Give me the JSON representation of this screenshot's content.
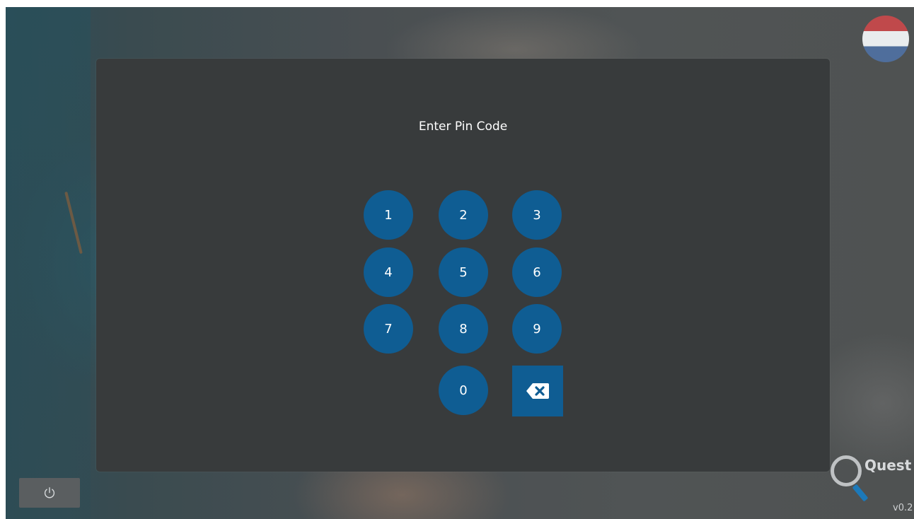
{
  "dialog": {
    "title": "Enter Pin Code"
  },
  "keypad": {
    "keys": [
      "1",
      "2",
      "3",
      "4",
      "5",
      "6",
      "7",
      "8",
      "9",
      "0"
    ],
    "backspace_icon": "backspace-icon"
  },
  "language": {
    "flag_icon": "netherlands-flag-icon"
  },
  "footer": {
    "power_icon": "power-icon",
    "brand_text": "Quest",
    "version": "v0.2"
  },
  "colors": {
    "key_blue": "#0f5d93",
    "dialog_bg": "#383b3c"
  }
}
